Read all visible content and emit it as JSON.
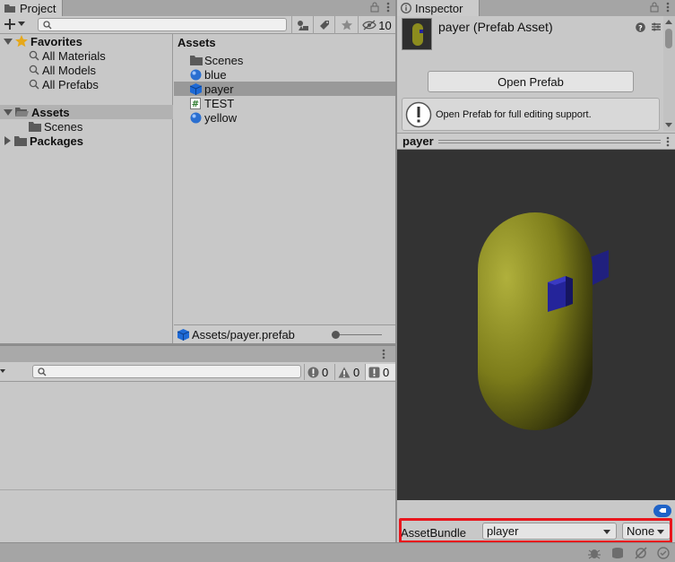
{
  "project": {
    "tab_label": "Project",
    "hidden_count": "10",
    "tree": {
      "favorites_label": "Favorites",
      "favorites_items": [
        "All Materials",
        "All Models",
        "All Prefabs"
      ],
      "assets_label": "Assets",
      "assets_children": [
        "Scenes"
      ],
      "packages_label": "Packages"
    },
    "assets_panel": {
      "header": "Assets",
      "items": [
        {
          "name": "Scenes",
          "icon": "folder-icon"
        },
        {
          "name": "blue",
          "icon": "material-sphere-icon"
        },
        {
          "name": "payer",
          "icon": "prefab-cube-icon"
        },
        {
          "name": "TEST",
          "icon": "script-icon"
        },
        {
          "name": "yellow",
          "icon": "material-sphere-icon"
        }
      ],
      "selected": "payer"
    },
    "path_bar": "Assets/payer.prefab"
  },
  "console": {
    "error_count": "0",
    "warning_count": "0",
    "message_count": "0"
  },
  "inspector": {
    "tab_label": "Inspector",
    "title": "payer (Prefab Asset)",
    "open_prefab_label": "Open Prefab",
    "help_text": "Open Prefab for full editing support.",
    "preview_title": "payer",
    "asset_bundle_label": "AssetBundle",
    "asset_bundle_value": "player",
    "asset_bundle_variant": "None"
  },
  "colors": {
    "capsule": "#8c8c1e",
    "wing": "#24249a",
    "preview_bg": "#333333",
    "highlight": "#e8161d"
  }
}
